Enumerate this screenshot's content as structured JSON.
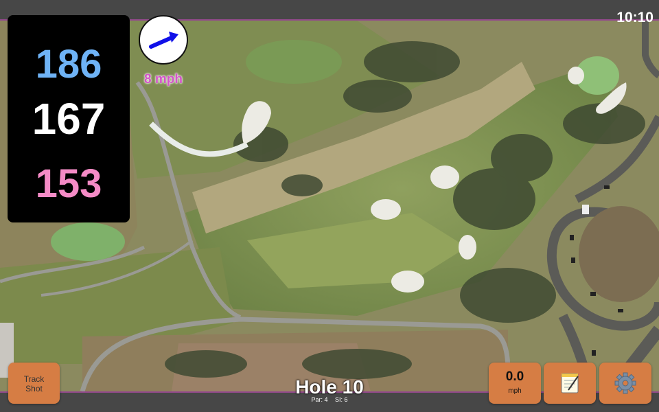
{
  "status_bar": {
    "time": "10:10"
  },
  "distances": {
    "back": "186",
    "middle": "167",
    "front": "153"
  },
  "wind": {
    "speed": "8 mph",
    "direction_icon": "arrow-icon"
  },
  "hole": {
    "title": "Hole 10",
    "par": "Par: 4",
    "stroke_index": "SI: 6"
  },
  "buttons": {
    "track_shot": "Track\nShot",
    "speed_value": "0.0",
    "speed_unit": "mph",
    "notes_icon": "notepad-icon",
    "settings_icon": "gear-icon"
  },
  "colors": {
    "back_distance": "#6fb3f6",
    "middle_distance": "#ffffff",
    "front_distance": "#f58bc6",
    "wind_speed": "#d356c8",
    "button": "#d67d44",
    "accent_line": "#b24aa8"
  }
}
